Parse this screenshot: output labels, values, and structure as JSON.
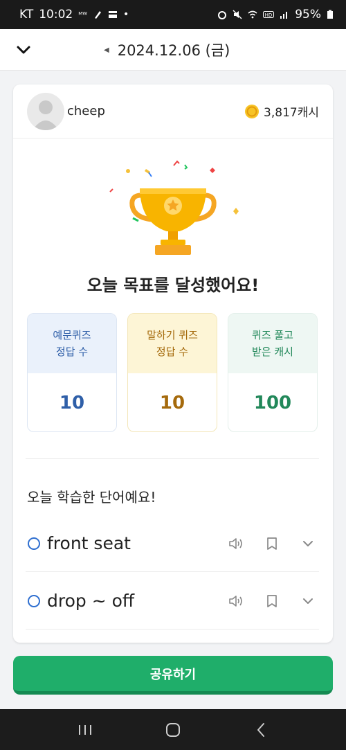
{
  "status_bar": {
    "carrier": "KT",
    "time": "10:02",
    "network_tag": "ᴹᵂ",
    "battery": "95%"
  },
  "header": {
    "date": "2024.12.06 (금)"
  },
  "profile": {
    "username": "cheep",
    "cash": "3,817캐시"
  },
  "headline": "오늘 목표를 달성했어요!",
  "stats": [
    {
      "label": "예문퀴즈\n정답 수",
      "value": "10"
    },
    {
      "label": "말하기 퀴즈\n정답 수",
      "value": "10"
    },
    {
      "label": "퀴즈 풀고\n받은 캐시",
      "value": "100"
    }
  ],
  "words_section": {
    "title": "오늘 학습한 단어예요!",
    "words": [
      {
        "text": "front seat"
      },
      {
        "text": "drop ~ off"
      }
    ]
  },
  "share_button": "공유하기",
  "colors": {
    "primary_green": "#1fae6a",
    "quiz_blue": "#2f5fa8",
    "speak_orange": "#a56a0c",
    "cash_green": "#22885a",
    "trophy_gold": "#f5a623"
  }
}
